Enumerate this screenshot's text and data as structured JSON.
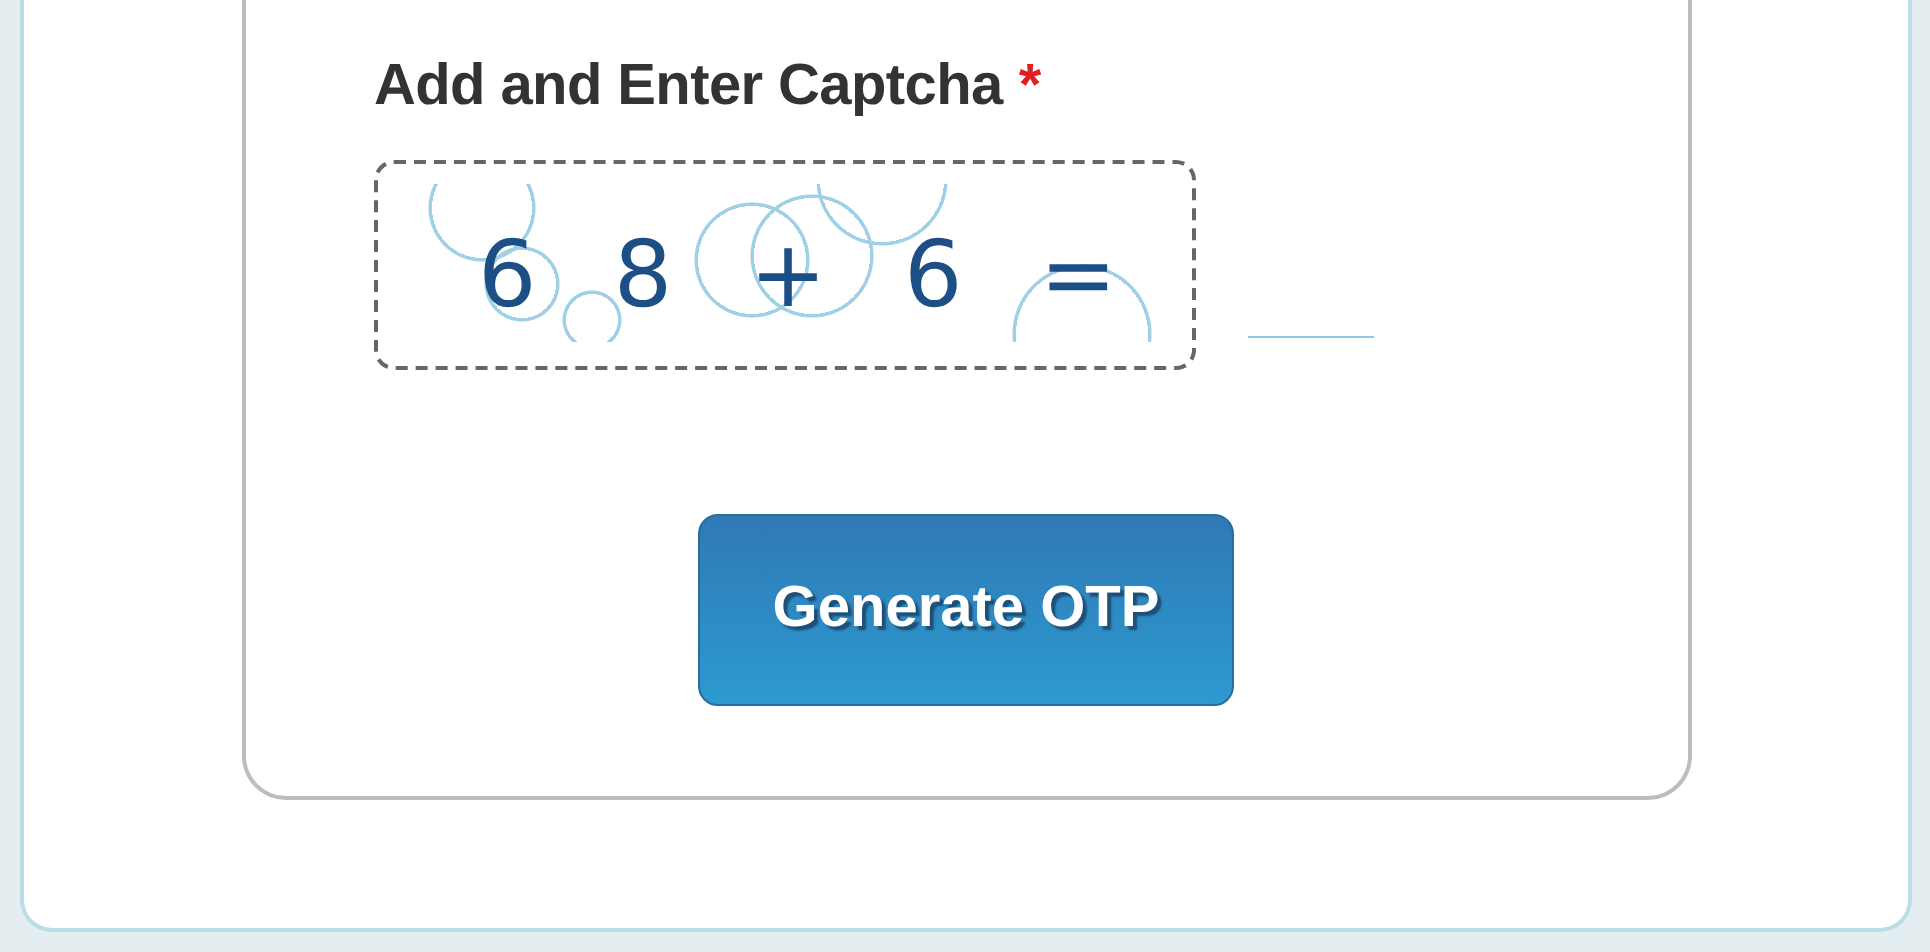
{
  "captcha": {
    "label": "Add and Enter Captcha",
    "required_mark": "*",
    "required": true,
    "image": {
      "kind": "picture",
      "text": "6 8 + 6 ="
    }
  },
  "submit_button": {
    "label": "Generate OTP"
  }
}
